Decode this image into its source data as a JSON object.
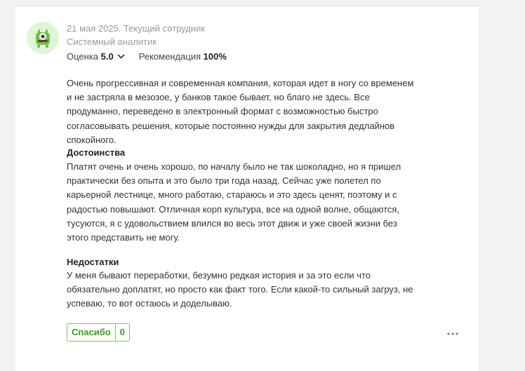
{
  "review": {
    "date_status": "21 мая 2025. Текущий сотрудник",
    "position": "Системный аналитик",
    "rating_label": "Оценка",
    "rating_value": "5.0",
    "recommend_label": "Рекомендация",
    "recommend_value": "100%",
    "intro": "Очень прогрессивная и современная компания, которая идет в ногу со временем и не застряла в мезозое, у банков такое бывает, но благо не здесь. Все продуманно, переведено в электронный формат с возможностью быстро согласовывать решения, которые постоянно нужды для закрытия дедлайнов спокойного.",
    "pros_title": "Достоинства",
    "pros": "Платят очень и очень хорошо, по началу было не так шоколадно, но я пришел практически без опыта и это было три года назад. Сейчас уже полетел по карьерной лестнице, много работаю, стараюсь и это здесь ценят, поэтому и с радостью повышают. Отличная корп культура, все на одной волне, общаются, тусуются, я с удовольствием влился во весь этот движ и уже своей жизни без этого представить не могу.",
    "cons_title": "Недостатки",
    "cons": "У меня бывают переработки, безумно редкая история и за это если что обязательно доплатят, но просто как факт того. Если какой-то сильный загруз, не успеваю, то вот остаюсь и доделываю.",
    "thanks_label": "Спасибо",
    "thanks_count": "0"
  },
  "icons": {
    "avatar": "monster-avatar-icon",
    "chevron": "chevron-down-icon",
    "more": "more-dots-icon"
  },
  "colors": {
    "accent_green": "#3a9d23",
    "avatar_bg": "#dff5d6"
  }
}
